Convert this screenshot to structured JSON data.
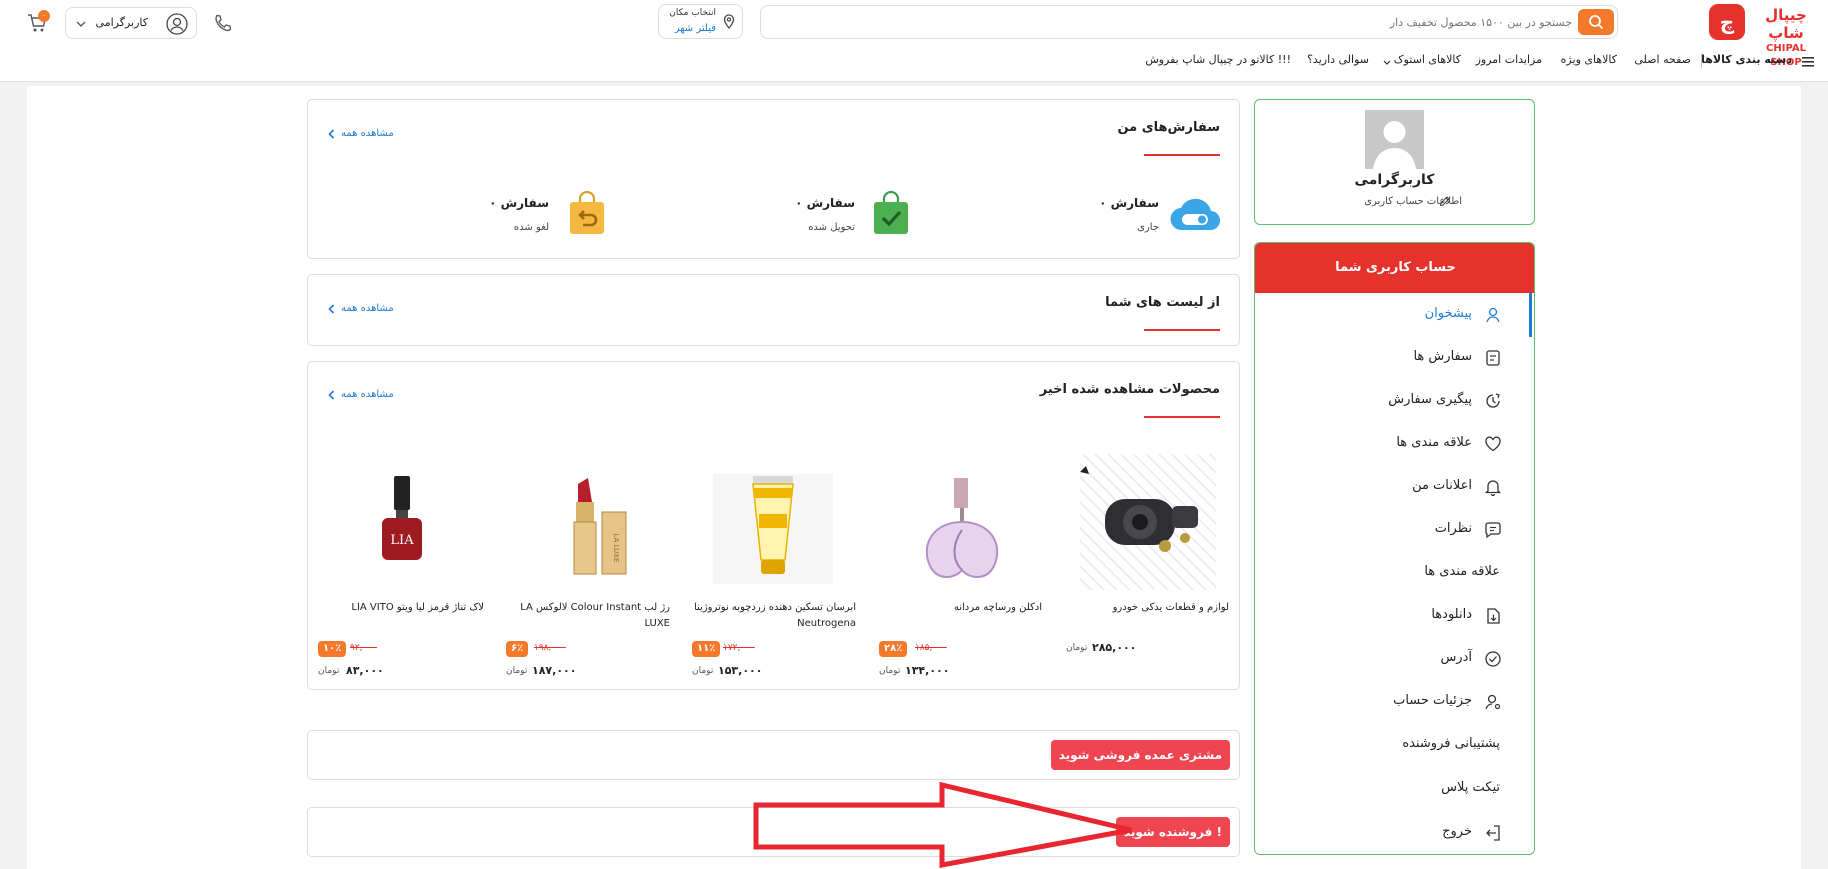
{
  "header": {
    "logo_mark": "چ",
    "logo_fa": "چیپال شاپ",
    "logo_en": "CHIPAL SHOP",
    "search_placeholder": "جستجو در بین ۱۵۰۰ محصول تخفیف دار",
    "location_title": "انتخاب مکان",
    "location_city": "فیلتر شهر",
    "user_name": "کاربرگرامی",
    "cart_count": "۰",
    "nav": {
      "categories": "دسته بندی کالاها",
      "home": "صفحه اصلی",
      "special": "کالاهای ویژه",
      "auctions": "مزایدات امروز",
      "stock": "کالاهای استوک",
      "question": "سوالی دارید؟",
      "sell": "کالاتو در چیپال شاپ بفروش !!!"
    }
  },
  "profile": {
    "name": "کاربرگرامی",
    "info_link": "اطلاعات حساب کاربری"
  },
  "sidebar": {
    "title": "حساب کاربری شما",
    "items": [
      {
        "label": "پیشخوان",
        "icon": "user-icon",
        "active": true
      },
      {
        "label": "سفارش ها",
        "icon": "orders-icon"
      },
      {
        "label": "پیگیری سفارش",
        "icon": "tracking-icon"
      },
      {
        "label": "علاقه مندی ها",
        "icon": "heart-icon"
      },
      {
        "label": "اعلانات من",
        "icon": "bell-icon"
      },
      {
        "label": "نظرات",
        "icon": "comment-icon"
      },
      {
        "label": "علاقه مندی ها",
        "icon": ""
      },
      {
        "label": "دانلودها",
        "icon": "download-icon"
      },
      {
        "label": "آدرس",
        "icon": "address-icon"
      },
      {
        "label": "جزئیات حساب",
        "icon": "account-icon"
      },
      {
        "label": "پشتیبانی فروشنده",
        "icon": ""
      },
      {
        "label": "تیکت پلاس",
        "icon": ""
      },
      {
        "label": "خروج",
        "icon": "logout-icon"
      }
    ]
  },
  "orders": {
    "title": "سفارش‌های من",
    "see_all": "مشاهده همه",
    "stats": [
      {
        "count": "۰ سفارش",
        "label": "جاری"
      },
      {
        "count": "۰ سفارش",
        "label": "تحویل شده"
      },
      {
        "count": "۰ سفارش",
        "label": "لغو شده"
      }
    ]
  },
  "lists": {
    "title": "از لیست های شما",
    "see_all": "مشاهده همه"
  },
  "recent": {
    "title": "محصولات مشاهده شده اخیر",
    "see_all": "مشاهده همه",
    "currency": "تومان",
    "products": [
      {
        "name": "لوازم و قطعات یدکی خودرو",
        "price": "۲۸۵,۰۰۰",
        "old_price": "",
        "discount": ""
      },
      {
        "name": "ادکلن ورساچه مردانه",
        "price": "۱۳۴,۰۰۰",
        "old_price": "۱۸۵,۰۰۰",
        "discount": "۲۸٪"
      },
      {
        "name": "ابرسان تسکین دهنده زردچوبه نوتروژینا Neutrogena",
        "price": "۱۵۳,۰۰۰",
        "old_price": "۱۷۲,۰۰۰",
        "discount": "۱۱٪"
      },
      {
        "name": "رژ لب Colour Instant لالوکس LA LUXE",
        "price": "۱۸۷,۰۰۰",
        "old_price": "۱۹۸,۰۰۰",
        "discount": "۶٪"
      },
      {
        "name": "لاک تناژ قرمز لیا ویتو LIA VITO",
        "price": "۸۳,۰۰۰",
        "old_price": "۹۲,۰۰۰",
        "discount": "۱۰٪"
      }
    ]
  },
  "wholesale_button": "مشتری عمده فروشی شوید",
  "seller_button": "فروشنده شوید !",
  "colors": {
    "brand_red": "#e5322d",
    "accent_orange": "#f4792b",
    "link_blue": "#1e7bd6",
    "sidebar_border": "#5cc16a",
    "annotation_arrow": "#e8262f"
  }
}
